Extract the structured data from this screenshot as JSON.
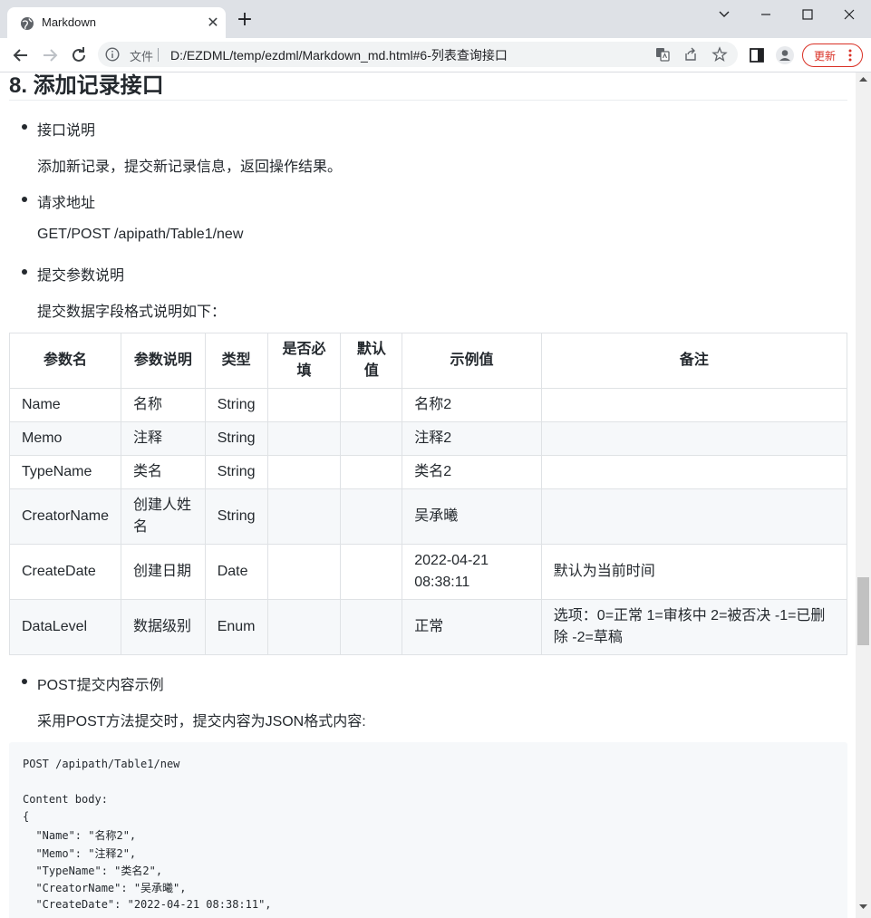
{
  "browser": {
    "tab_title": "Markdown",
    "file_label": "文件",
    "url": "D:/EZDML/temp/ezdml/Markdown_md.html#6-列表查询接口",
    "update_label": "更新"
  },
  "doc": {
    "section_title": "8. 添加记录接口",
    "items": [
      {
        "label": "接口说明",
        "text": "添加新记录，提交新记录信息，返回操作结果。"
      },
      {
        "label": "请求地址",
        "text": "GET/POST /apipath/Table1/new"
      },
      {
        "label": "提交参数说明",
        "text": "提交数据字段格式说明如下："
      },
      {
        "label": "POST提交内容示例",
        "text": "采用POST方法提交时，提交内容为JSON格式内容:"
      }
    ],
    "table": {
      "headers": [
        "参数名",
        "参数说明",
        "类型",
        "是否必填",
        "默认值",
        "示例值",
        "备注"
      ],
      "rows": [
        [
          "Name",
          "名称",
          "String",
          "",
          "",
          "名称2",
          ""
        ],
        [
          "Memo",
          "注释",
          "String",
          "",
          "",
          "注释2",
          ""
        ],
        [
          "TypeName",
          "类名",
          "String",
          "",
          "",
          "类名2",
          ""
        ],
        [
          "CreatorName",
          "创建人姓名",
          "String",
          "",
          "",
          "吴承曦",
          ""
        ],
        [
          "CreateDate",
          "创建日期",
          "Date",
          "",
          "",
          "2022-04-21 08:38:11",
          "默认为当前时间"
        ],
        [
          "DataLevel",
          "数据级别",
          "Enum",
          "",
          "",
          "正常",
          "选项：0=正常 1=审核中 2=被否决 -1=已删除 -2=草稿"
        ]
      ]
    },
    "code_lines": [
      "POST /apipath/Table1/new",
      "",
      "Content body:",
      "{",
      "  \"Name\": \"名称2\",",
      "  \"Memo\": \"注释2\",",
      "  \"TypeName\": \"类名2\",",
      "  \"CreatorName\": \"吴承曦\",",
      "  \"CreateDate\": \"2022-04-21 08:38:11\","
    ]
  },
  "colors": {
    "accent_red": "#d93025",
    "tabstrip": "#dee1e6",
    "code_bg": "#f6f8fa"
  }
}
